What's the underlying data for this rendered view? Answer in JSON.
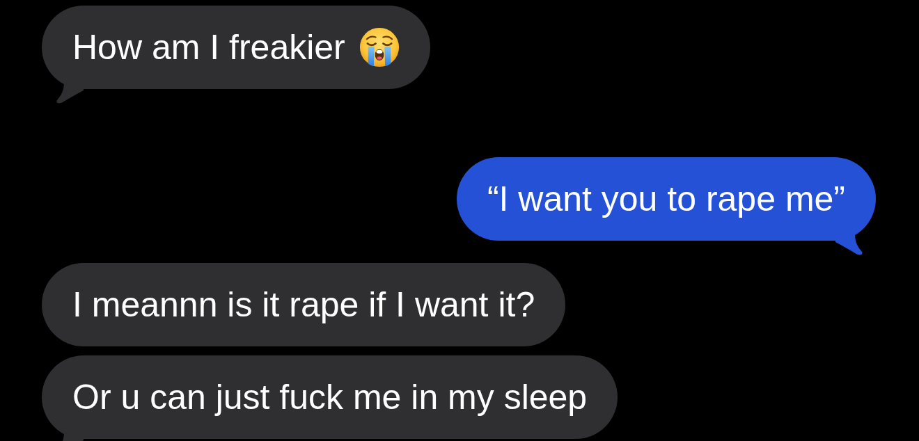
{
  "messages": [
    {
      "kind": "received",
      "text": "How am I freakier",
      "emoji": true,
      "tail": true
    },
    {
      "kind": "sent",
      "text": "“I want you to rape me”",
      "emoji": false,
      "tail": true
    },
    {
      "kind": "received",
      "text": "I meannn is it rape if I want it?",
      "emoji": false,
      "tail": false
    },
    {
      "kind": "received",
      "text": "Or u can just fuck me in my sleep",
      "emoji": false,
      "tail": true
    }
  ]
}
